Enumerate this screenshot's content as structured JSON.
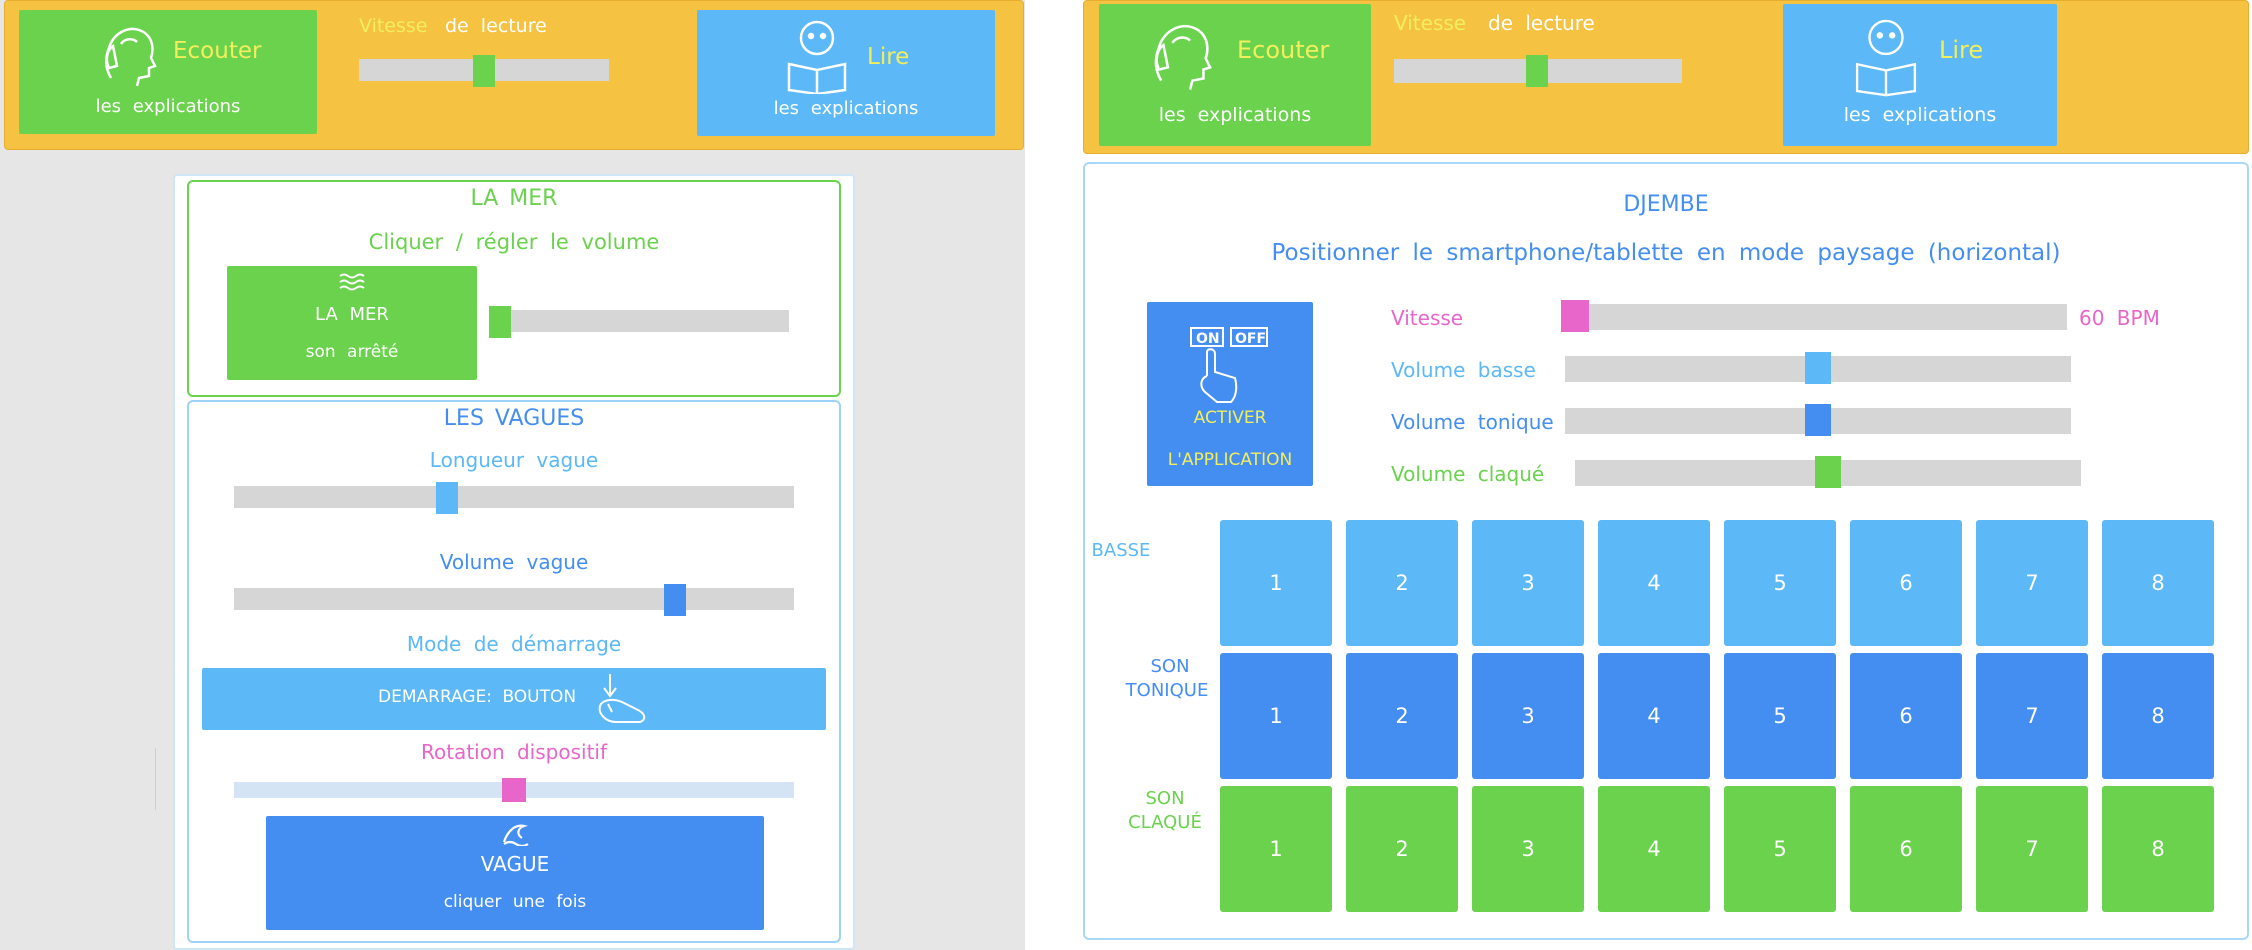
{
  "left": {
    "header": {
      "listen_title": "Ecouter",
      "listen_sub": "les explications",
      "speed_word1": "Vitesse",
      "speed_word2": "de lecture",
      "speed_value": 0.5,
      "read_title": "Lire",
      "read_sub": "les explications"
    },
    "sea": {
      "title": "LA MER",
      "subtitle": "Cliquer / régler le volume",
      "button_title": "LA MER",
      "button_status": "son arrêté",
      "volume": 0.0
    },
    "waves": {
      "title": "LES VAGUES",
      "length_label": "Longueur vague",
      "length_value": 0.38,
      "volume_label": "Volume vague",
      "volume_value": 0.8,
      "mode_label": "Mode de démarrage",
      "mode_button": "DEMARRAGE: BOUTON",
      "rotation_label": "Rotation dispositif",
      "rotation_value": 0.5,
      "wave_button_title": "VAGUE",
      "wave_button_sub": "cliquer une fois"
    }
  },
  "right": {
    "header": {
      "listen_title": "Ecouter",
      "listen_sub": "les explications",
      "speed_word1": "Vitesse",
      "speed_word2": "de lecture",
      "speed_value": 0.5,
      "read_title": "Lire",
      "read_sub": "les explications"
    },
    "djembe": {
      "title": "DJEMBE",
      "subtitle": "Positionner le smartphone/tablette en mode paysage (horizontal)",
      "activate_line1": "ACTIVER",
      "activate_line2": "L'APPLICATION",
      "toggle_on": "ON",
      "toggle_off": "OFF",
      "speed_label": "Vitesse",
      "speed_value": 0.0,
      "speed_readout": "60 BPM",
      "bass_label": "Volume basse",
      "bass_value": 0.5,
      "tone_label": "Volume tonique",
      "tone_value": 0.5,
      "slap_label": "Volume claqué",
      "slap_value": 0.5,
      "rows": [
        {
          "label_line1": "BASSE",
          "label_line2": "",
          "pads": [
            "1",
            "2",
            "3",
            "4",
            "5",
            "6",
            "7",
            "8"
          ]
        },
        {
          "label_line1": "SON",
          "label_line2": "TONIQUE",
          "pads": [
            "1",
            "2",
            "3",
            "4",
            "5",
            "6",
            "7",
            "8"
          ]
        },
        {
          "label_line1": "SON",
          "label_line2": "CLAQUÉ",
          "pads": [
            "1",
            "2",
            "3",
            "4",
            "5",
            "6",
            "7",
            "8"
          ]
        }
      ]
    }
  },
  "colors": {
    "header_bg": "#f5c242",
    "green": "#6bd24e",
    "light_blue": "#5cb8f7",
    "dark_blue": "#458ef1",
    "pink": "#e866c9",
    "yellow_text": "#f2ee5c",
    "grey_track": "#d6d6d6"
  },
  "icons": [
    "head-listening-icon",
    "person-reading-icon",
    "waves-icon",
    "hand-pointer-icon",
    "wave-icon",
    "on-off-hand-icon"
  ]
}
